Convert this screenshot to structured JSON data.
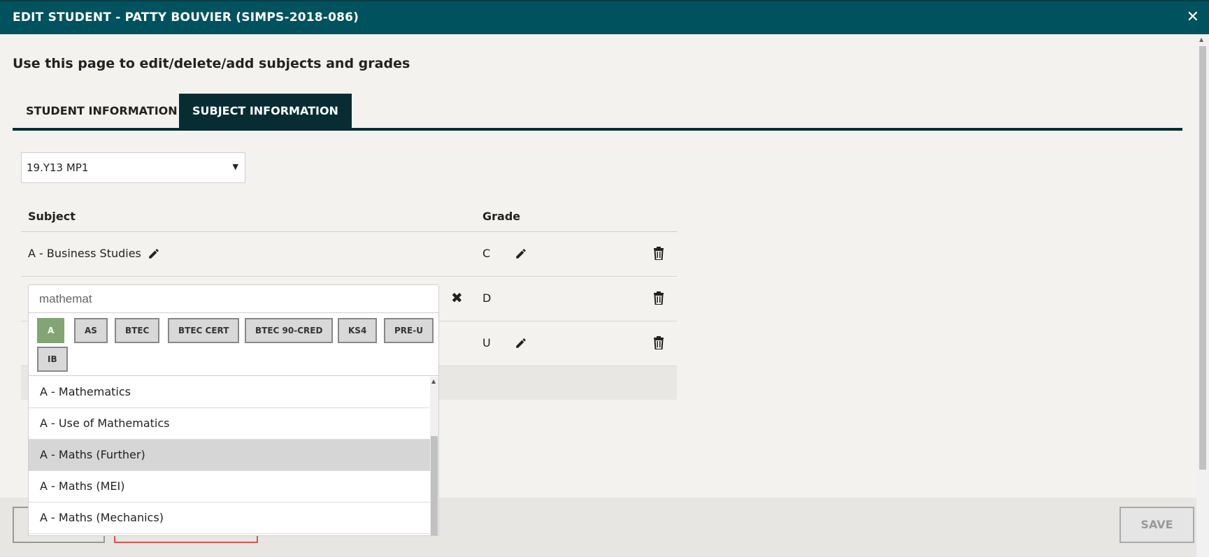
{
  "window": {
    "title": "EDIT STUDENT - PATTY BOUVIER (SIMPS-2018-086)",
    "close_glyph": "✕"
  },
  "page": {
    "subtitle": "Use this page to edit/delete/add subjects and grades"
  },
  "tabs": [
    {
      "label": "STUDENT INFORMATION",
      "active": false
    },
    {
      "label": "SUBJECT INFORMATION",
      "active": true
    }
  ],
  "cohort_select": {
    "value": "19.Y13 MP1"
  },
  "table": {
    "headers": {
      "subject": "Subject",
      "grade": "Grade"
    },
    "rows": [
      {
        "subject": "A - Business Studies",
        "grade": "C"
      },
      {
        "subject": "",
        "grade": "D",
        "editing": true
      },
      {
        "subject": "",
        "grade": "U"
      }
    ]
  },
  "subject_search": {
    "value": "mathemat",
    "qualification_filters": [
      "A",
      "AS",
      "BTEC",
      "BTEC CERT",
      "BTEC 90-CRED",
      "KS4",
      "PRE-U",
      "IB"
    ],
    "active_filter": "A",
    "results": [
      "A - Mathematics",
      "A - Use of Mathematics",
      "A - Maths (Further)",
      "A - Maths (MEI)",
      "A - Maths (Mechanics)"
    ],
    "highlighted_result": "A - Maths (Further)"
  },
  "footer": {
    "save_label": "SAVE"
  },
  "colors": {
    "header_bg": "#00525e",
    "tab_active_bg": "#072d33",
    "filter_active": "#82a573",
    "delete_border": "#d9534f"
  }
}
